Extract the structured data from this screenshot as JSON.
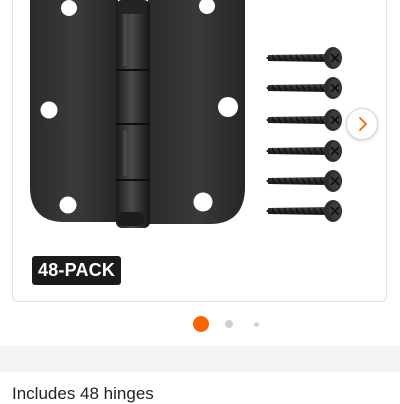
{
  "gallery": {
    "badge_text": "48-PACK",
    "next_icon": "chevron-right-icon",
    "slide_count": 3,
    "active_slide": 1,
    "accent_color": "#f96302"
  },
  "product": {
    "feature_text": "Includes 48 hinges"
  }
}
